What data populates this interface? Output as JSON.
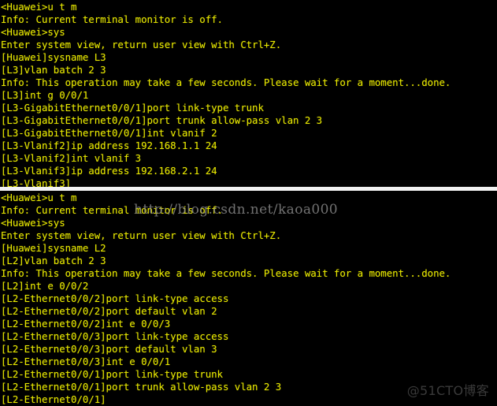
{
  "colors": {
    "background": "#000000",
    "text": "#e8e800",
    "separator": "#f2f2f2",
    "watermark_url": "#8c8c8c",
    "watermark_brand": "#3a3a3a"
  },
  "panels": [
    {
      "id": "l3-switch-console",
      "device": "L3",
      "lines": [
        "<Huawei>u t m",
        "Info: Current terminal monitor is off.",
        "<Huawei>sys",
        "Enter system view, return user view with Ctrl+Z.",
        "[Huawei]sysname L3",
        "[L3]vlan batch 2 3",
        "Info: This operation may take a few seconds. Please wait for a moment...done.",
        "[L3]int g 0/0/1",
        "[L3-GigabitEthernet0/0/1]port link-type trunk",
        "[L3-GigabitEthernet0/0/1]port trunk allow-pass vlan 2 3",
        "[L3-GigabitEthernet0/0/1]int vlanif 2",
        "[L3-Vlanif2]ip address 192.168.1.1 24",
        "[L3-Vlanif2]int vlanif 3",
        "[L3-Vlanif3]ip address 192.168.2.1 24",
        "[L3-Vlanif3]"
      ]
    },
    {
      "id": "l2-switch-console",
      "device": "L2",
      "lines": [
        "<Huawei>u t m",
        "Info: Current terminal monitor is off.",
        "<Huawei>sys",
        "Enter system view, return user view with Ctrl+Z.",
        "[Huawei]sysname L2",
        "[L2]vlan batch 2 3",
        "Info: This operation may take a few seconds. Please wait for a moment...done.",
        "[L2]int e 0/0/2",
        "[L2-Ethernet0/0/2]port link-type access",
        "[L2-Ethernet0/0/2]port default vlan 2",
        "[L2-Ethernet0/0/2]int e 0/0/3",
        "[L2-Ethernet0/0/3]port link-type access",
        "[L2-Ethernet0/0/3]port default vlan 3",
        "[L2-Ethernet0/0/3]int e 0/0/1",
        "[L2-Ethernet0/0/1]port link-type trunk",
        "[L2-Ethernet0/0/1]port trunk allow-pass vlan 2 3",
        "[L2-Ethernet0/0/1]"
      ]
    }
  ],
  "watermarks": {
    "url": "http://blog.csdn.net/kaoa000",
    "brand": "@51CTO博客"
  }
}
